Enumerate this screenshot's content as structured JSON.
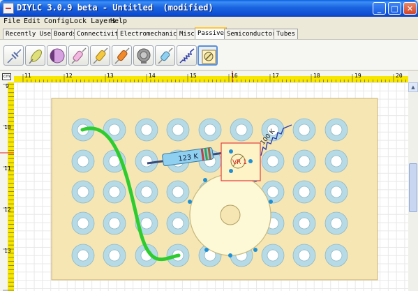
{
  "window": {
    "title": "DIYLC 3.0.9 beta - Untitled  (modified)",
    "buttons": {
      "minimize": "_",
      "maximize": "□",
      "close": "✕"
    }
  },
  "menu": [
    "File",
    "Edit",
    "Config",
    "Lock Layers",
    "Help"
  ],
  "tabs": [
    "Recently Used",
    "Boards",
    "Connectivity",
    "Electromechanical",
    "Misc",
    "Passive",
    "Semiconductors",
    "Tubes"
  ],
  "active_tab": "Passive",
  "toolbar": {
    "tools": [
      {
        "icon": "capacitor-icon"
      },
      {
        "icon": "ceramic-capacitor-icon"
      },
      {
        "icon": "electrolytic-capacitor-icon"
      },
      {
        "icon": "film-capacitor-icon"
      },
      {
        "icon": "axial-capacitor-icon"
      },
      {
        "icon": "tantalum-capacitor-icon"
      },
      {
        "icon": "potentiometer-icon"
      },
      {
        "icon": "resistor-icon"
      },
      {
        "icon": "resistor-symbol-icon"
      },
      {
        "icon": "trimmer-potentiometer-icon"
      }
    ],
    "selected_index": 9
  },
  "ruler": {
    "unit_label": "cm",
    "h_labels": [
      "11",
      "12",
      "13",
      "14",
      "15",
      "16",
      "17",
      "18",
      "19",
      "20"
    ],
    "v_labels": [
      "9",
      "10",
      "11",
      "12",
      "13"
    ]
  },
  "canvas": {
    "resistor_label": "123 K",
    "resistor_symbol_label": "100 K",
    "trimmer_label": "VR 1"
  },
  "colors": {
    "board": "#f6e6b4",
    "pad_ring": "#b6dbe6",
    "wire": "#2ecc2e",
    "selection": "#1e90d6",
    "trimmer_border": "#e33c3c",
    "pot_body": "#fdf8d6"
  }
}
